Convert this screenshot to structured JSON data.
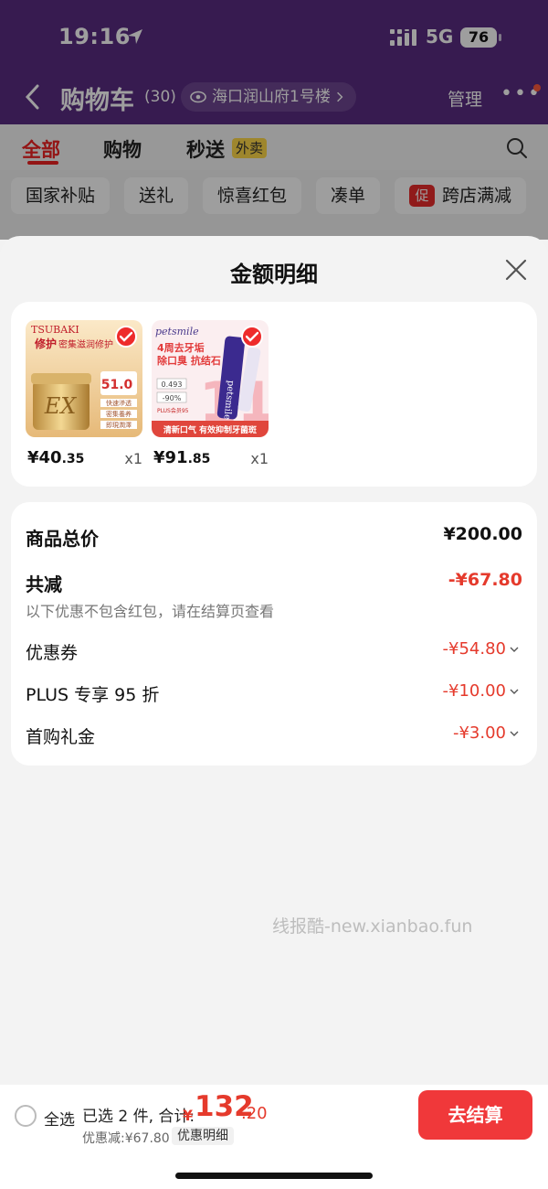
{
  "status_bar": {
    "time": "19:16",
    "network": "5G",
    "battery": "76"
  },
  "nav": {
    "title": "购物车",
    "count": "(30)",
    "address": "海口润山府1号楼",
    "manage_label": "管理"
  },
  "tabs": [
    {
      "label": "全部"
    },
    {
      "label": "购物"
    },
    {
      "label": "秒送"
    }
  ],
  "tab_badge": "外卖",
  "chips": [
    "国家补贴",
    "送礼",
    "惊喜红包",
    "凑单",
    "跨店满减"
  ],
  "promo_badge": "促",
  "sheet": {
    "title": "金额明细"
  },
  "products": [
    {
      "brand": "TSUBAKI",
      "headline": "修护",
      "subline": "密集滋润修护",
      "badge_price": "51.0",
      "price_symbol": "¥",
      "price_int": "40",
      "price_dec": ".35",
      "qty": "x1",
      "tag1": "快速滲透",
      "tag2": "密集養养",
      "tag3": "即現潤澤",
      "logo_text": "EX"
    },
    {
      "brand": "petsmile",
      "headline": "4周去牙垢",
      "subline": "除口臭 抗结石",
      "stats": [
        "0.493",
        "-90%"
      ],
      "footer": "清新口气 有效抑制牙菌斑",
      "plus_text": "PLUS会员95",
      "price_symbol": "¥",
      "price_int": "91",
      "price_dec": ".85",
      "qty": "x1",
      "tube_text": "petsmile"
    }
  ],
  "detail": {
    "total_label": "商品总价",
    "total_value": "¥200.00",
    "reduce_label": "共减",
    "reduce_value": "-¥67.80",
    "note": "以下优惠不包含红包，请在结算页查看",
    "items": [
      {
        "label": "优惠券",
        "value": "-¥54.80"
      },
      {
        "label": "PLUS 专享 95 折",
        "value": "-¥10.00"
      },
      {
        "label": "首购礼金",
        "value": "-¥3.00"
      }
    ]
  },
  "watermark": "线报酷-new.xianbao.fun",
  "bottom": {
    "select_all": "全选",
    "selected_text": "已选 2 件, 合计:",
    "currency": "¥",
    "total_int": "132",
    "total_dec": ".20",
    "saved_text": "优惠减:¥67.80",
    "detail_link": "优惠明细",
    "checkout_label": "去结算"
  },
  "colors": {
    "header_purple": "#5a2d82",
    "accent_red": "#e53a2c",
    "checkout_red": "#f0383a",
    "tag_yellow": "#ffd84a"
  },
  "icons": [
    "location-arrow-icon",
    "signal-icon",
    "back-chevron-icon",
    "eye-icon",
    "chevron-right-icon",
    "more-dots-icon",
    "search-icon",
    "close-icon",
    "check-icon",
    "chevron-down-icon",
    "radio-icon"
  ]
}
